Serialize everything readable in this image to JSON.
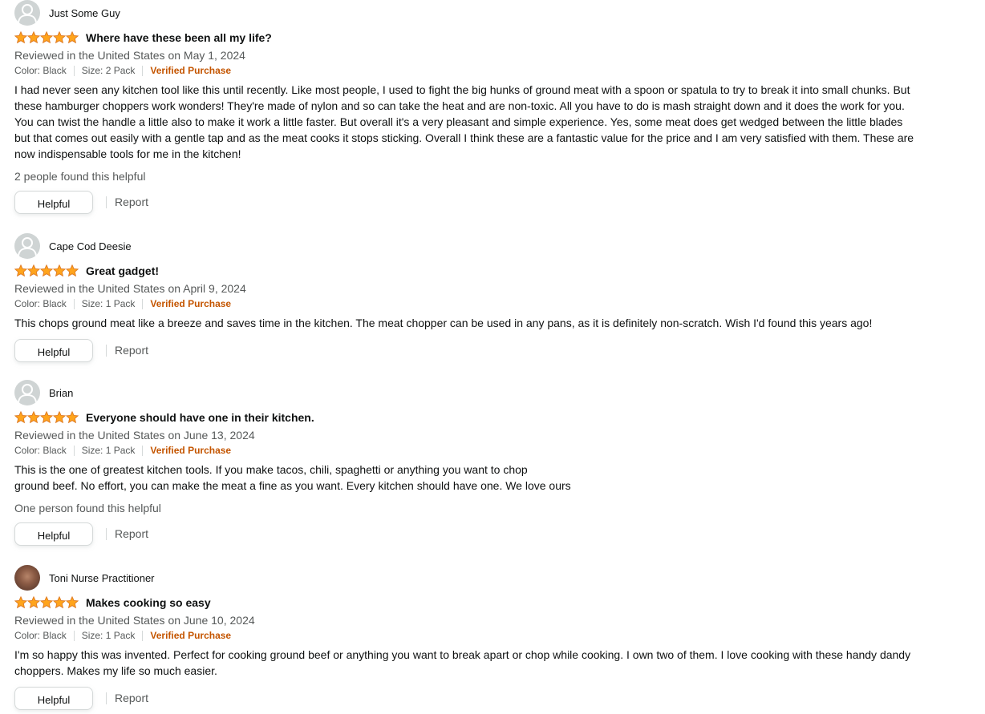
{
  "colors": {
    "star": "#ffa41c",
    "star_stroke": "#de7921",
    "verified": "#c45500",
    "muted_text": "#565959",
    "main_text": "#0f1111",
    "avatar_bg": "#cfd4d4"
  },
  "icons": {
    "avatar_default": "person-silhouette-icon",
    "star": "star-icon"
  },
  "reviews": [
    {
      "author": "Just Some Guy",
      "avatar": "default",
      "rating": 5,
      "title": "Where have these been all my life?",
      "date": "Reviewed in the United States on May 1, 2024",
      "color": "Color: Black",
      "size": "Size: 2 Pack",
      "verified": "Verified Purchase",
      "body": "I had never seen any kitchen tool like this until recently. Like most people, I used to fight the big hunks of ground meat with a spoon or spatula to try to break it into small chunks. But these hamburger choppers work wonders! They're made of nylon and so can take the heat and are non-toxic. All you have to do is mash straight down and it does the work for you. You can twist the handle a little also to make it work a little faster. But overall it's a very pleasant and simple experience. Yes, some meat does get wedged between the little blades but that comes out easily with a gentle tap and as the meat cooks it stops sticking. Overall I think these are a fantastic value for the price and I am very satisfied with them. These are now indispensable tools for me in the kitchen!",
      "helpful_count": "2 people found this helpful",
      "helpful_label": "Helpful",
      "report_label": "Report"
    },
    {
      "author": "Cape Cod Deesie",
      "avatar": "default",
      "rating": 5,
      "title": "Great gadget!",
      "date": "Reviewed in the United States on April 9, 2024",
      "color": "Color: Black",
      "size": "Size: 1 Pack",
      "verified": "Verified Purchase",
      "body": "This chops ground meat like a breeze and saves time in the kitchen. The meat chopper can be used in any pans, as it is definitely non-scratch. Wish I'd found this years ago!",
      "helpful_count": "",
      "helpful_label": "Helpful",
      "report_label": "Report"
    },
    {
      "author": "Brian",
      "avatar": "default",
      "rating": 5,
      "title": "Everyone should have one in their kitchen.",
      "date": "Reviewed in the United States on June 13, 2024",
      "color": "Color: Black",
      "size": "Size: 1 Pack",
      "verified": "Verified Purchase",
      "body_lines": [
        "This is the one of greatest kitchen tools. If you make tacos, chili, spaghetti or anything you want to chop",
        "ground beef. No effort, you can make the meat a fine as you want. Every kitchen should have one. We love ours"
      ],
      "helpful_count": "One person found this helpful",
      "helpful_label": "Helpful",
      "report_label": "Report"
    },
    {
      "author": "Toni Nurse Practitioner",
      "avatar": "photo",
      "rating": 5,
      "title": "Makes cooking so easy",
      "date": "Reviewed in the United States on June 10, 2024",
      "color": "Color: Black",
      "size": "Size: 1 Pack",
      "verified": "Verified Purchase",
      "body": "I'm so happy this was invented. Perfect for cooking ground beef or anything you want to break apart or chop while cooking. I own two of them. I love cooking with these handy dandy choppers. Makes my life so much easier.",
      "helpful_count": "",
      "helpful_label": "Helpful",
      "report_label": "Report"
    }
  ]
}
